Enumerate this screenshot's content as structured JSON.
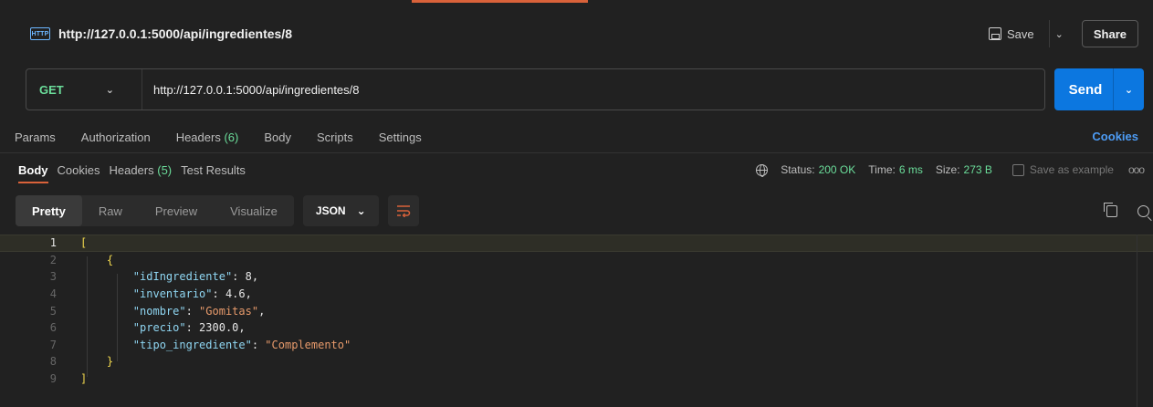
{
  "request": {
    "tab_icon": "HTTP",
    "title": "http://127.0.0.1:5000/api/ingredientes/8",
    "save_label": "Save",
    "share_label": "Share",
    "method": "GET",
    "url": "http://127.0.0.1:5000/api/ingredientes/8",
    "send_label": "Send"
  },
  "request_tabs": {
    "params": "Params",
    "authorization": "Authorization",
    "headers": "Headers",
    "headers_count": "(6)",
    "body": "Body",
    "scripts": "Scripts",
    "settings": "Settings",
    "cookies": "Cookies"
  },
  "response_tabs": {
    "body": "Body",
    "cookies": "Cookies",
    "headers": "Headers",
    "headers_count": "(5)",
    "test_results": "Test Results"
  },
  "response_status": {
    "status_label": "Status:",
    "status_value": "200 OK",
    "time_label": "Time:",
    "time_value": "6 ms",
    "size_label": "Size:",
    "size_value": "273 B",
    "save_example": "Save as example",
    "more": "ooo"
  },
  "response_toolbar": {
    "pretty": "Pretty",
    "raw": "Raw",
    "preview": "Preview",
    "visualize": "Visualize",
    "format": "JSON"
  },
  "editor": {
    "line_numbers": [
      "1",
      "2",
      "3",
      "4",
      "5",
      "6",
      "7",
      "8",
      "9"
    ],
    "open_array": "[",
    "open_object": "{",
    "close_object": "}",
    "close_array": "]",
    "fields": [
      {
        "key": "\"idIngrediente\"",
        "value": "8",
        "type": "num"
      },
      {
        "key": "\"inventario\"",
        "value": "4.6",
        "type": "num"
      },
      {
        "key": "\"nombre\"",
        "value": "\"Gomitas\"",
        "type": "str"
      },
      {
        "key": "\"precio\"",
        "value": "2300.0",
        "type": "num"
      },
      {
        "key": "\"tipo_ingrediente\"",
        "value": "\"Complemento\"",
        "type": "str"
      }
    ]
  },
  "colors": {
    "accent": "#d9623a",
    "send": "#0c77e0",
    "success": "#6bdd9a",
    "link": "#4d9cf5"
  }
}
